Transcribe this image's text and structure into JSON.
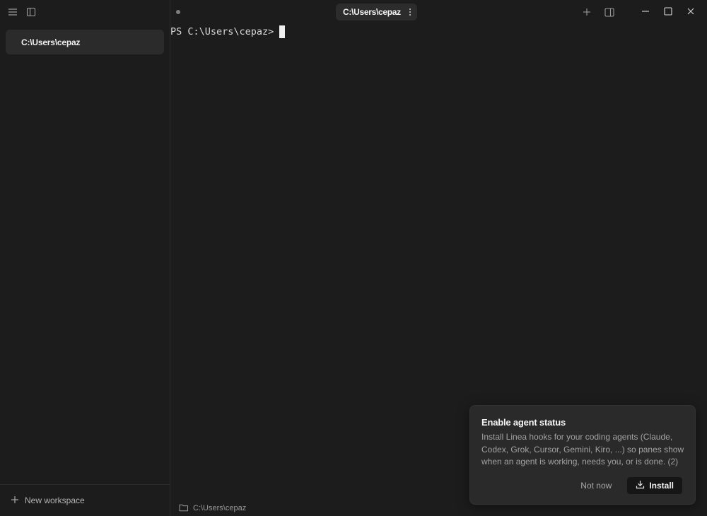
{
  "sidebar": {
    "workspaces": [
      {
        "label": "C:\\Users\\cepaz"
      }
    ],
    "new_workspace_label": "New workspace"
  },
  "tab": {
    "label": "C:\\Users\\cepaz"
  },
  "terminal": {
    "prompt": "PS C:\\Users\\cepaz>"
  },
  "status_bar": {
    "path": "C:\\Users\\cepaz"
  },
  "toast": {
    "title": "Enable agent status",
    "body": "Install Linea hooks for your coding agents (Claude, Codex, Grok, Cursor, Gemini, Kiro, ...) so panes show when an agent is working, needs you, or is done. (2)",
    "dismiss_label": "Not now",
    "install_label": "Install"
  },
  "icons": [
    "menu-icon",
    "sidebar-toggle-icon",
    "plus-icon",
    "split-pane-icon",
    "minimize-icon",
    "maximize-icon",
    "close-icon",
    "kebab-icon",
    "folder-icon",
    "download-icon"
  ]
}
